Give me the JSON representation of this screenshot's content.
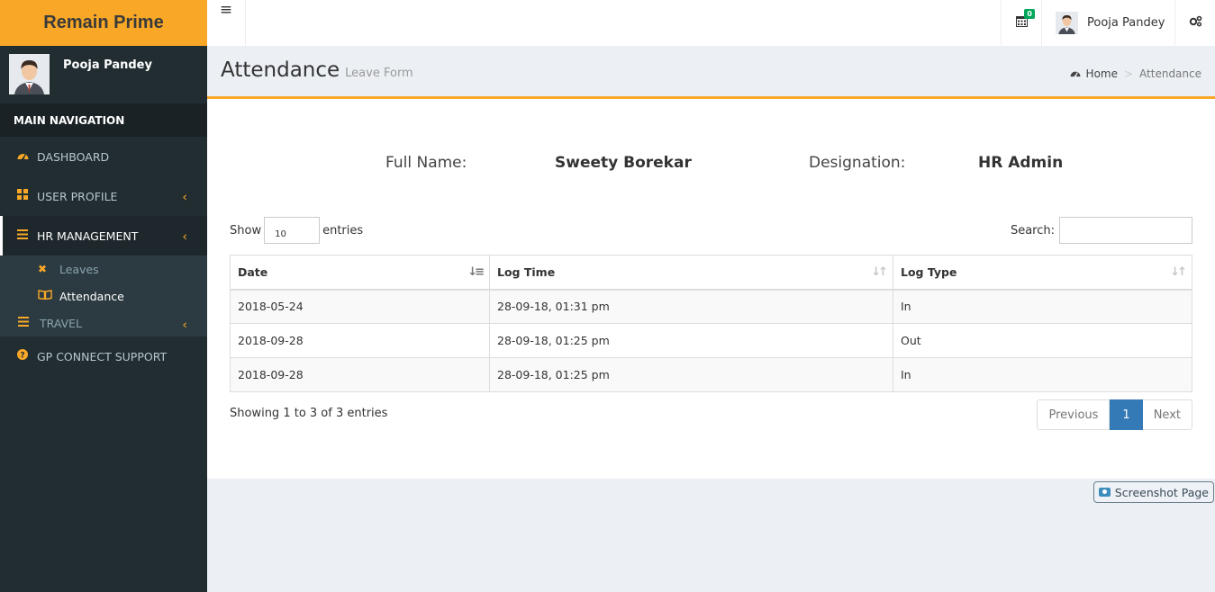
{
  "brand": {
    "title": "Remain Prime",
    "color": "#f8a826"
  },
  "sidebar": {
    "user_name": "Pooja Pandey",
    "nav_header": "MAIN NAVIGATION",
    "items": [
      {
        "label": "DASHBOARD",
        "icon": "dashboard-icon"
      },
      {
        "label": "USER PROFILE",
        "icon": "th-large-icon"
      },
      {
        "label": "HR MANAGEMENT",
        "icon": "bars-icon"
      },
      {
        "label": "GP CONNECT SUPPORT",
        "icon": "question-circle-icon"
      }
    ],
    "submenu": [
      {
        "label": "Leaves",
        "icon": "close-icon"
      },
      {
        "label": "Attendance",
        "icon": "book-icon"
      },
      {
        "label": "TRAVEL",
        "icon": "bars-icon"
      }
    ]
  },
  "topbar": {
    "menu_toggle": "≡",
    "calendar_badge": "0",
    "user_name": "Pooja Pandey"
  },
  "content_header": {
    "title": "Attendance",
    "subtitle": "Leave Form",
    "breadcrumb": {
      "home": "Home",
      "current": "Attendance"
    }
  },
  "employee": {
    "name_label": "Full Name:",
    "name_value": "Sweety Borekar",
    "designation_label": "Designation:",
    "designation_value": "HR Admin"
  },
  "table_controls": {
    "show_label": "Show",
    "page_length": "10",
    "entries_label": "entries",
    "search_label": "Search:",
    "search_value": ""
  },
  "table": {
    "columns": [
      "Date",
      "Log Time",
      "Log Type"
    ],
    "rows": [
      [
        "2018-05-24",
        "28-09-18, 01:31 pm",
        "In"
      ],
      [
        "2018-09-28",
        "28-09-18, 01:25 pm",
        "Out"
      ],
      [
        "2018-09-28",
        "28-09-18, 01:25 pm",
        "In"
      ]
    ]
  },
  "pagination": {
    "info": "Showing 1 to 3 of 3 entries",
    "previous": "Previous",
    "current_page": "1",
    "next": "Next"
  },
  "screenshot_button": "Screenshot Page"
}
